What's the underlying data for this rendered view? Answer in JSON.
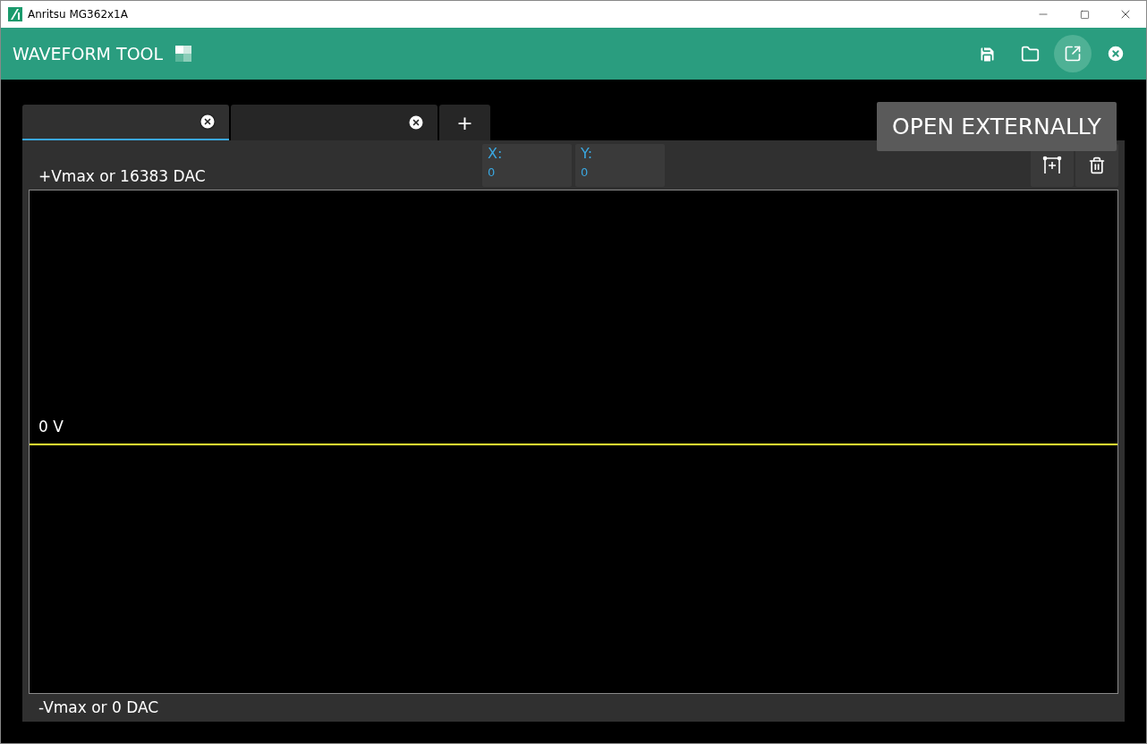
{
  "window": {
    "title": "Anritsu MG362x1A"
  },
  "header": {
    "title": "WAVEFORM TOOL"
  },
  "tooltip": "OPEN EXTERNALLY",
  "tabs": [
    {
      "selected": true
    },
    {
      "selected": false
    }
  ],
  "add_tab": "+",
  "cursor": {
    "x_label": "X:",
    "x_value": "0",
    "y_label": "Y:",
    "y_value": "0"
  },
  "plot": {
    "top_label": "+Vmax or 16383 DAC",
    "zero_label": "0 V",
    "bottom_label": "-Vmax or 0 DAC"
  }
}
